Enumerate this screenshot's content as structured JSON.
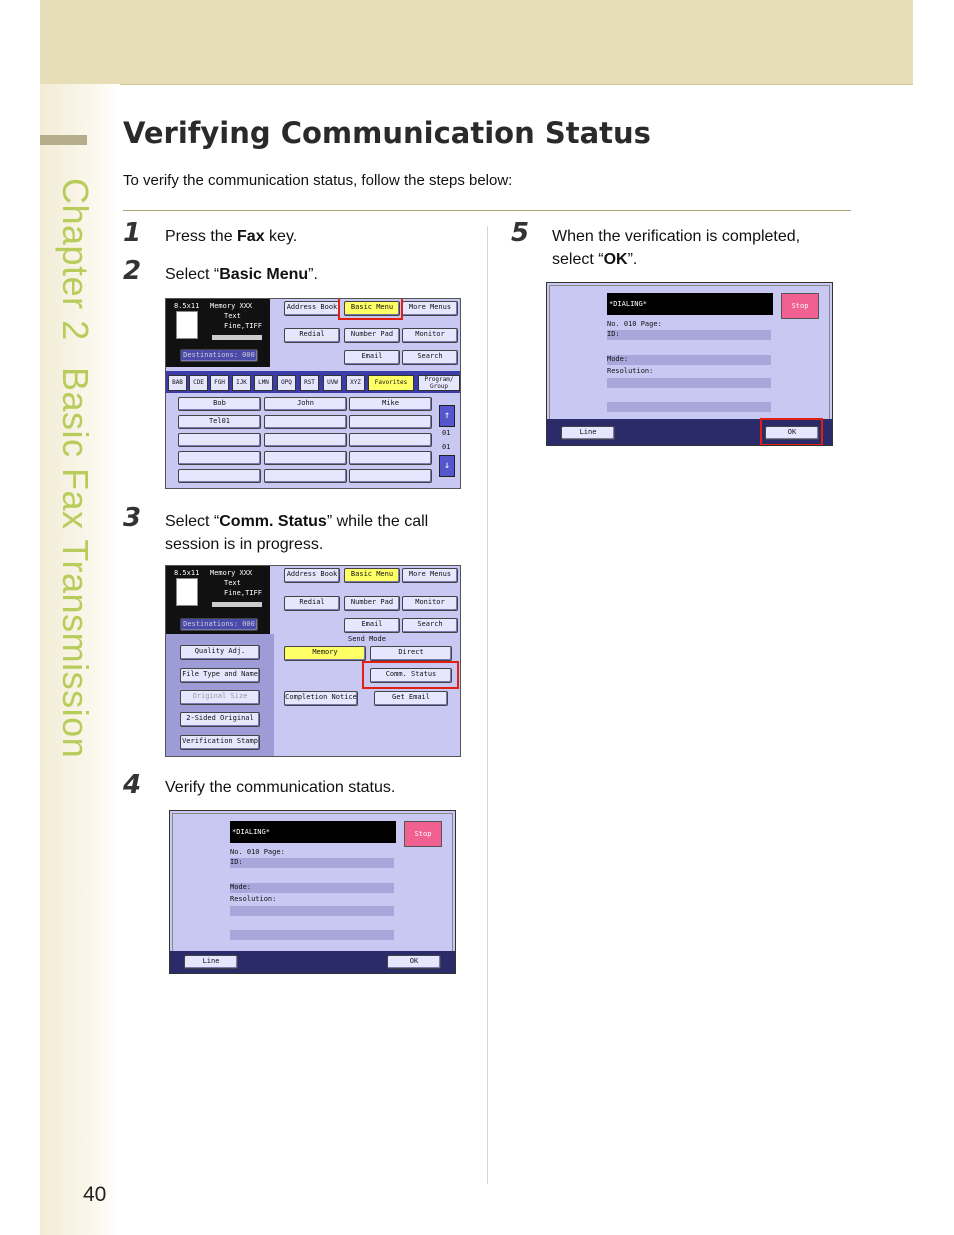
{
  "chapter_label": {
    "part1": "Chapter 2",
    "part2": "Basic Fax Transmission"
  },
  "title": "Verifying Communication Status",
  "intro": "To verify the communication status, follow the steps below:",
  "page_number": "40",
  "steps": {
    "s1": {
      "num": "1",
      "pre": "Press the ",
      "bold": "Fax",
      "post": " key."
    },
    "s2": {
      "num": "2",
      "pre": "Select “",
      "bold": "Basic Menu",
      "post": "”."
    },
    "s3": {
      "num": "3",
      "pre": "Select “",
      "bold": "Comm. Status",
      "post": "” while the call session is in progress."
    },
    "s4": {
      "num": "4",
      "text": "Verify the communication status."
    },
    "s5": {
      "num": "5",
      "pre": "When the verification is completed, select “",
      "bold": "OK",
      "post": "”."
    }
  },
  "screen_a": {
    "paper": "8.5x11",
    "memory": "Memory XXX",
    "mode_text": "Text",
    "resolution": "Fine,TIFF",
    "destinations": "Destinations: 000",
    "tabs_top": [
      "Address Book",
      "Basic Menu",
      "More Menus"
    ],
    "row2": [
      "Redial",
      "Number Pad",
      "Monitor"
    ],
    "row3": [
      "Email",
      "Search"
    ],
    "alpha_tabs": [
      "BAB",
      "CDE",
      "FGH",
      "IJK",
      "LMN",
      "OPQ",
      "RST",
      "UVW",
      "XYZ",
      "Favorites",
      "Program/ Group"
    ],
    "contacts": [
      "Bob",
      "John",
      "Mike",
      "Tel01"
    ],
    "page_top": "01",
    "page_bottom": "01"
  },
  "screen_b": {
    "paper": "8.5x11",
    "memory": "Memory XXX",
    "mode_text": "Text",
    "resolution": "Fine,TIFF",
    "destinations": "Destinations: 000",
    "tabs_top": [
      "Address Book",
      "Basic Menu",
      "More Menus"
    ],
    "row2": [
      "Redial",
      "Number Pad",
      "Monitor"
    ],
    "row3": [
      "Email",
      "Search"
    ],
    "left_buttons": [
      "Quality Adj.",
      "File Type and Name",
      "Original Size",
      "2-Sided Original",
      "Verification Stamp"
    ],
    "send_mode_label": "Send Mode",
    "send_modes": [
      "Memory",
      "Direct"
    ],
    "comm_status": "Comm. Status",
    "completion_notice": "Completion Notice",
    "get_email": "Get Email"
  },
  "screen_status": {
    "dialing": "*DIALING*",
    "stop": "Stop",
    "no_line": "No. 010  Page:",
    "id_line": "ID:",
    "mode_line": "Mode:",
    "resolution_line": "Resolution:",
    "line_btn": "Line",
    "ok_btn": "OK"
  }
}
